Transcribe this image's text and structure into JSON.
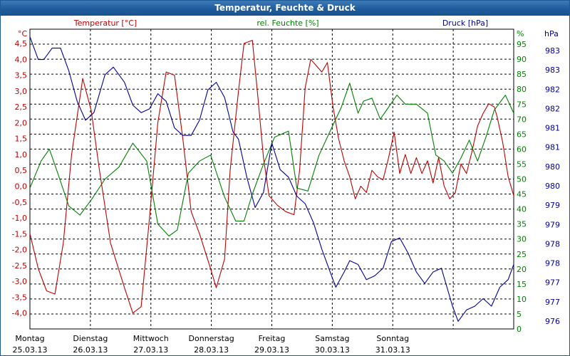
{
  "window": {
    "title": "Temperatur, Feuchte & Druck"
  },
  "chart_data": {
    "type": "line",
    "title": "Temperatur, Feuchte & Druck",
    "grid": true,
    "days": [
      {
        "day": "Montag",
        "date": "25.03.13"
      },
      {
        "day": "Dienstag",
        "date": "26.03.13"
      },
      {
        "day": "Mittwoch",
        "date": "27.03.13"
      },
      {
        "day": "Donnerstag",
        "date": "28.03.13"
      },
      {
        "day": "Freitag",
        "date": "29.03.13"
      },
      {
        "day": "Samstag",
        "date": "30.03.13"
      },
      {
        "day": "Sonntag",
        "date": "31.03.13"
      }
    ],
    "x_range": [
      "25.03.13 00:00",
      "01.04.13 06:00"
    ],
    "axes": {
      "temperature": {
        "unit": "°C",
        "ylim": [
          -4.5,
          4.95
        ],
        "ticks": [
          "4,5",
          "4,0",
          "3,5",
          "3,0",
          "2,5",
          "2,0",
          "1,5",
          "1,0",
          "0,5",
          "0,0",
          "-0,5",
          "-1,0",
          "-1,5",
          "-2,0",
          "-2,5",
          "-3,0",
          "-3,5",
          "-4,0"
        ],
        "color": "#c00000"
      },
      "humidity": {
        "unit": "%",
        "ylim": [
          0,
          100
        ],
        "ticks": [
          "95",
          "90",
          "85",
          "80",
          "75",
          "70",
          "65",
          "60",
          "55",
          "50",
          "45",
          "40",
          "35",
          "30",
          "25",
          "20",
          "15",
          "10",
          "5",
          "0"
        ],
        "color": "#008000"
      },
      "pressure": {
        "unit": "hPa",
        "ylim": [
          975.7,
          983.6
        ],
        "ticks": [
          "983",
          "983",
          "982",
          "982",
          "981",
          "981",
          "980",
          "980",
          "979",
          "979",
          "978",
          "978",
          "977",
          "977",
          "976"
        ],
        "color": "#000099"
      }
    },
    "series": [
      {
        "name": "Temperatur [°C]",
        "axis": "temperature",
        "color": "#c00000",
        "points": [
          [
            "25.03.13 00:00",
            -1.5
          ],
          [
            "25.03.13 03:00",
            -2.6
          ],
          [
            "25.03.13 06:00",
            -3.3
          ],
          [
            "25.03.13 09:00",
            -3.4
          ],
          [
            "25.03.13 12:00",
            -1.8
          ],
          [
            "25.03.13 15:00",
            1.0
          ],
          [
            "25.03.13 19:00",
            3.4
          ],
          [
            "25.03.13 22:00",
            2.4
          ],
          [
            "26.03.13 01:00",
            0.5
          ],
          [
            "26.03.13 05:00",
            -1.8
          ],
          [
            "26.03.13 10:00",
            -3.2
          ],
          [
            "26.03.13 13:00",
            -4.0
          ],
          [
            "26.03.13 16:00",
            -3.8
          ],
          [
            "26.03.13 19:00",
            -1.0
          ],
          [
            "26.03.13 22:00",
            2.0
          ],
          [
            "27.03.13 01:00",
            3.6
          ],
          [
            "27.03.13 04:00",
            3.5
          ],
          [
            "27.03.13 07:00",
            1.5
          ],
          [
            "27.03.13 10:00",
            -0.8
          ],
          [
            "27.03.13 13:00",
            -1.5
          ],
          [
            "27.03.13 17:00",
            -2.6
          ],
          [
            "27.03.13 19:00",
            -3.2
          ],
          [
            "27.03.13 22:00",
            -2.3
          ],
          [
            "28.03.13 00:00",
            0.5
          ],
          [
            "28.03.13 03:00",
            3.0
          ],
          [
            "28.03.13 05:00",
            4.5
          ],
          [
            "28.03.13 08:00",
            4.6
          ],
          [
            "28.03.13 10:00",
            2.8
          ],
          [
            "28.03.13 12:00",
            0.9
          ],
          [
            "28.03.13 14:00",
            -0.3
          ],
          [
            "28.03.13 17:00",
            -0.6
          ],
          [
            "28.03.13 20:00",
            -0.8
          ],
          [
            "28.03.13 23:00",
            -0.9
          ],
          [
            "29.03.13 01:00",
            0.5
          ],
          [
            "29.03.13 03:00",
            3.1
          ],
          [
            "29.03.13 05:00",
            4.0
          ],
          [
            "29.03.13 07:00",
            3.8
          ],
          [
            "29.03.13 09:00",
            3.6
          ],
          [
            "29.03.13 11:00",
            3.9
          ],
          [
            "29.03.13 13:00",
            2.5
          ],
          [
            "29.03.13 15:00",
            1.5
          ],
          [
            "29.03.13 17:00",
            0.8
          ],
          [
            "29.03.13 19:00",
            0.3
          ],
          [
            "29.03.13 21:00",
            -0.4
          ],
          [
            "29.03.13 23:00",
            0.0
          ],
          [
            "30.03.13 01:00",
            -0.2
          ],
          [
            "30.03.13 03:00",
            0.5
          ],
          [
            "30.03.13 05:00",
            0.3
          ],
          [
            "30.03.13 07:00",
            0.2
          ],
          [
            "30.03.13 09:00",
            0.9
          ],
          [
            "30.03.13 11:00",
            1.7
          ],
          [
            "30.03.13 13:00",
            0.4
          ],
          [
            "30.03.13 15:00",
            1.0
          ],
          [
            "30.03.13 17:00",
            0.4
          ],
          [
            "30.03.13 19:00",
            0.9
          ],
          [
            "30.03.13 21:00",
            0.4
          ],
          [
            "30.03.13 23:00",
            0.8
          ],
          [
            "31.03.13 01:00",
            0.1
          ],
          [
            "31.03.13 03:00",
            0.9
          ],
          [
            "31.03.13 05:00",
            0.0
          ],
          [
            "31.03.13 07:00",
            -0.4
          ],
          [
            "31.03.13 09:00",
            -0.2
          ],
          [
            "31.03.13 11:00",
            0.7
          ],
          [
            "31.03.13 13:00",
            0.4
          ],
          [
            "31.03.13 15:00",
            1.1
          ],
          [
            "31.03.13 17:00",
            1.9
          ],
          [
            "31.03.13 19:00",
            2.3
          ],
          [
            "31.03.13 21:00",
            2.6
          ],
          [
            "31.03.13 23:00",
            2.5
          ],
          [
            "01.04.13 00:00",
            2.2
          ],
          [
            "01.04.13 02:00",
            1.4
          ],
          [
            "01.04.13 04:00",
            0.3
          ],
          [
            "01.04.13 06:00",
            -0.3
          ],
          [
            "01.04.13 08:00",
            1.0
          ],
          [
            "01.04.13 10:00",
            1.3
          ],
          [
            "01.04.13 12:00",
            1.1
          ],
          [
            "01.04.13 14:00",
            1.7
          ],
          [
            "01.04.13 16:00",
            2.1
          ],
          [
            "01.04.13 18:00",
            2.5
          ],
          [
            "01.04.13 20:00",
            2.2
          ],
          [
            "01.04.13 22:00",
            1.5
          ],
          [
            "02.04.13 00:00",
            0.9
          ],
          [
            "02.04.13 02:00",
            0.3
          ]
        ]
      },
      {
        "name": "rel. Feuchte [%]",
        "axis": "humidity",
        "color": "#008000",
        "points": [
          [
            "25.03.13 00:00",
            47
          ],
          [
            "25.03.13 04:00",
            56
          ],
          [
            "25.03.13 07:00",
            60
          ],
          [
            "25.03.13 10:00",
            52
          ],
          [
            "25.03.13 14:00",
            41
          ],
          [
            "25.03.13 18:00",
            38
          ],
          [
            "25.03.13 22:00",
            43
          ],
          [
            "26.03.13 03:00",
            50
          ],
          [
            "26.03.13 08:00",
            54
          ],
          [
            "26.03.13 13:00",
            62
          ],
          [
            "26.03.13 18:00",
            56
          ],
          [
            "26.03.13 22:00",
            35
          ],
          [
            "27.03.13 02:00",
            31
          ],
          [
            "27.03.13 05:00",
            33
          ],
          [
            "27.03.13 09:00",
            52
          ],
          [
            "27.03.13 13:00",
            56
          ],
          [
            "27.03.13 17:00",
            58
          ],
          [
            "27.03.13 22:00",
            44
          ],
          [
            "28.03.13 02:00",
            36
          ],
          [
            "28.03.13 05:00",
            36
          ],
          [
            "28.03.13 08:00",
            45
          ],
          [
            "28.03.13 12:00",
            55
          ],
          [
            "28.03.13 16:00",
            64
          ],
          [
            "28.03.13 21:00",
            66
          ],
          [
            "29.03.13 00:00",
            47
          ],
          [
            "29.03.13 04:00",
            46
          ],
          [
            "29.03.13 08:00",
            58
          ],
          [
            "29.03.13 12:00",
            66
          ],
          [
            "29.03.13 16:00",
            74
          ],
          [
            "29.03.13 19:00",
            82
          ],
          [
            "29.03.13 22:00",
            72
          ],
          [
            "30.03.13 00:00",
            76
          ],
          [
            "30.03.13 03:00",
            77
          ],
          [
            "30.03.13 06:00",
            70
          ],
          [
            "30.03.13 09:00",
            74
          ],
          [
            "30.03.13 12:00",
            78
          ],
          [
            "30.03.13 15:00",
            75
          ],
          [
            "30.03.13 19:00",
            75
          ],
          [
            "30.03.13 23:00",
            72
          ],
          [
            "31.03.13 02:00",
            58
          ],
          [
            "31.03.13 05:00",
            56
          ],
          [
            "31.03.13 08:00",
            52
          ],
          [
            "31.03.13 11:00",
            57
          ],
          [
            "31.03.13 14:00",
            63
          ],
          [
            "31.03.13 17:00",
            56
          ],
          [
            "31.03.13 20:00",
            64
          ],
          [
            "31.03.13 23:00",
            73
          ],
          [
            "01.04.13 03:00",
            78
          ],
          [
            "01.04.13 06:00",
            72
          ],
          [
            "01.04.13 09:00",
            74
          ],
          [
            "01.04.13 12:00",
            76
          ],
          [
            "01.04.13 14:00",
            65
          ],
          [
            "01.04.13 16:00",
            62
          ],
          [
            "01.04.13 18:00",
            61
          ],
          [
            "01.04.13 20:00",
            63
          ],
          [
            "01.04.13 22:00",
            65
          ],
          [
            "02.04.13 00:00",
            66
          ],
          [
            "02.04.13 02:00",
            72
          ],
          [
            "02.04.13 03:00",
            73
          ]
        ]
      },
      {
        "name": "Druck [hPa]",
        "axis": "pressure",
        "color": "#000099",
        "points": [
          [
            "25.03.13 00:00",
            983.4
          ],
          [
            "25.03.13 03:00",
            982.8
          ],
          [
            "25.03.13 05:00",
            982.8
          ],
          [
            "25.03.13 08:00",
            983.1
          ],
          [
            "25.03.13 11:00",
            983.1
          ],
          [
            "25.03.13 14:00",
            982.5
          ],
          [
            "25.03.13 17:00",
            981.7
          ],
          [
            "25.03.13 20:00",
            981.2
          ],
          [
            "25.03.13 23:00",
            981.4
          ],
          [
            "26.03.13 03:00",
            982.4
          ],
          [
            "26.03.13 06:00",
            982.6
          ],
          [
            "26.03.13 10:00",
            982.2
          ],
          [
            "26.03.13 13:00",
            981.6
          ],
          [
            "26.03.13 16:00",
            981.4
          ],
          [
            "26.03.13 19:00",
            981.5
          ],
          [
            "26.03.13 22:00",
            981.9
          ],
          [
            "27.03.13 01:00",
            981.7
          ],
          [
            "27.03.13 04:00",
            981.0
          ],
          [
            "27.03.13 07:00",
            980.8
          ],
          [
            "27.03.13 10:00",
            980.8
          ],
          [
            "27.03.13 13:00",
            981.2
          ],
          [
            "27.03.13 16:00",
            982.0
          ],
          [
            "27.03.13 19:00",
            982.2
          ],
          [
            "27.03.13 22:00",
            981.8
          ],
          [
            "28.03.13 01:00",
            980.9
          ],
          [
            "28.03.13 03:00",
            980.7
          ],
          [
            "28.03.13 06:00",
            979.7
          ],
          [
            "28.03.13 09:00",
            978.9
          ],
          [
            "28.03.13 12:00",
            979.3
          ],
          [
            "28.03.13 15:00",
            980.6
          ],
          [
            "28.03.13 18:00",
            979.9
          ],
          [
            "28.03.13 21:00",
            979.7
          ],
          [
            "29.03.13 00:00",
            979.2
          ],
          [
            "29.03.13 03:00",
            979.0
          ],
          [
            "29.03.13 06:00",
            978.5
          ],
          [
            "29.03.13 09:00",
            977.8
          ],
          [
            "29.03.13 12:00",
            977.2
          ],
          [
            "29.03.13 14:00",
            976.8
          ],
          [
            "29.03.13 17:00",
            977.2
          ],
          [
            "29.03.13 19:00",
            977.5
          ],
          [
            "29.03.13 22:00",
            977.4
          ],
          [
            "30.03.13 01:00",
            977.0
          ],
          [
            "30.03.13 04:00",
            977.1
          ],
          [
            "30.03.13 07:00",
            977.3
          ],
          [
            "30.03.13 10:00",
            978.0
          ],
          [
            "30.03.13 13:00",
            978.1
          ],
          [
            "30.03.13 16:00",
            977.7
          ],
          [
            "30.03.13 19:00",
            977.2
          ],
          [
            "30.03.13 22:00",
            976.9
          ],
          [
            "31.03.13 01:00",
            977.2
          ],
          [
            "31.03.13 04:00",
            977.3
          ],
          [
            "31.03.13 06:00",
            976.8
          ],
          [
            "31.03.13 08:00",
            976.3
          ],
          [
            "31.03.13 10:00",
            975.9
          ],
          [
            "31.03.13 13:00",
            976.2
          ],
          [
            "31.03.13 16:00",
            976.3
          ],
          [
            "31.03.13 19:00",
            976.5
          ],
          [
            "31.03.13 22:00",
            976.3
          ],
          [
            "01.04.13 01:00",
            976.8
          ],
          [
            "01.04.13 04:00",
            977.0
          ],
          [
            "01.04.13 07:00",
            977.6
          ],
          [
            "01.04.13 10:00",
            978.8
          ],
          [
            "01.04.13 13:00",
            979.7
          ],
          [
            "01.04.13 16:00",
            979.9
          ],
          [
            "01.04.13 19:00",
            980.3
          ],
          [
            "01.04.13 22:00",
            981.2
          ],
          [
            "02.04.13 01:00",
            981.9
          ],
          [
            "02.04.13 04:00",
            981.6
          ],
          [
            "02.04.13 07:00",
            981.2
          ],
          [
            "02.04.13 10:00",
            981.4
          ],
          [
            "02.04.13 13:00",
            981.8
          ],
          [
            "02.04.13 16:00",
            982.3
          ],
          [
            "02.04.13 19:00",
            982.2
          ],
          [
            "02.04.13 22:00",
            981.9
          ]
        ]
      }
    ]
  }
}
